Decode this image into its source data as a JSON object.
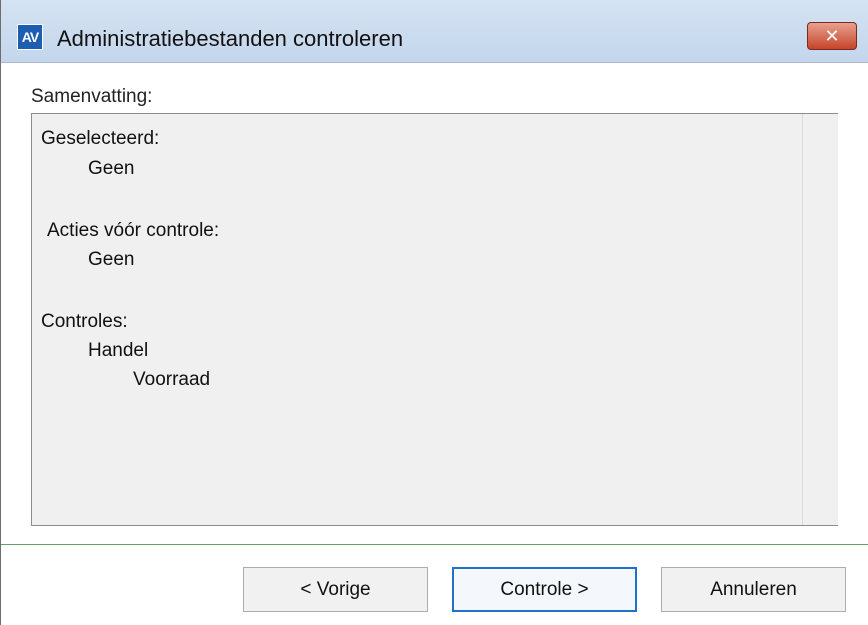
{
  "window": {
    "title": "Administratiebestanden controleren",
    "app_icon_text": "AV",
    "close_symbol": "✕"
  },
  "summary": {
    "label": "Samenvatting:",
    "sections": [
      {
        "heading": "Geselecteerd:",
        "items": [
          "Geen"
        ]
      },
      {
        "heading": "Acties vóór controle:",
        "items": [
          "Geen"
        ]
      },
      {
        "heading": "Controles:",
        "items": [
          "Handel",
          "Voorraad"
        ]
      }
    ]
  },
  "buttons": {
    "previous": "< Vorige",
    "check": "Controle >",
    "cancel": "Annuleren"
  },
  "colors": {
    "accent": "#1e73c8",
    "titlebar": "#c9dbef",
    "close": "#c7432b",
    "separator": "#63a36a"
  }
}
